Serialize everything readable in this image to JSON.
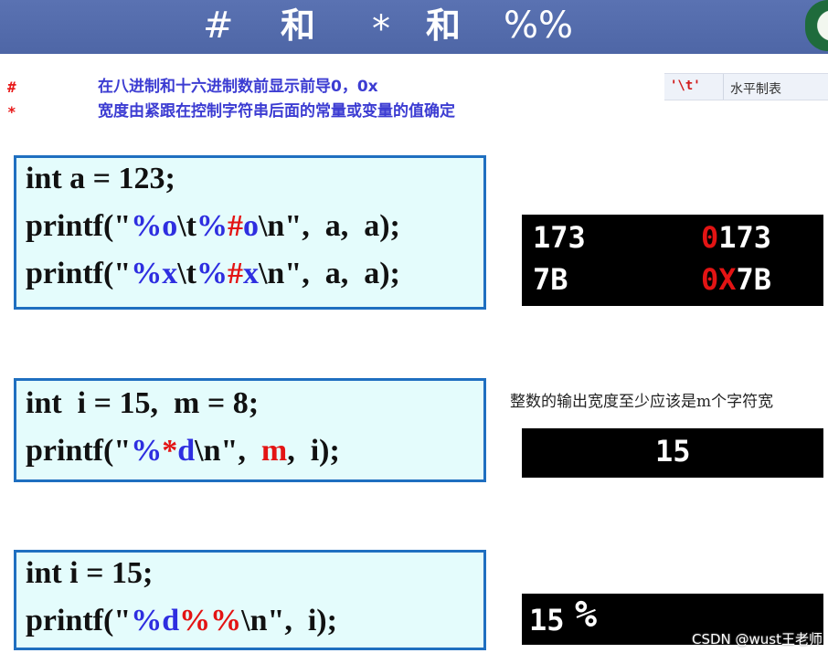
{
  "header": {
    "hash": "#",
    "he1": "和",
    "star": "*",
    "he2": "和",
    "percent": "%%"
  },
  "descriptions": [
    {
      "symbol": "#",
      "text": "在八进制和十六进制数前显示前导0，0x"
    },
    {
      "symbol": "*",
      "text": "宽度由紧跟在控制字符串后面的常量或变量的值确定"
    }
  ],
  "tab_table": {
    "code": "'\\t'",
    "desc": "水平制表"
  },
  "examples": [
    {
      "code": [
        [
          {
            "t": "int a = 123;",
            "c": ""
          }
        ],
        [
          {
            "t": "printf(\"",
            "c": ""
          },
          {
            "t": "%o",
            "c": "b"
          },
          {
            "t": "\\t",
            "c": ""
          },
          {
            "t": "%",
            "c": "b"
          },
          {
            "t": "#",
            "c": "r"
          },
          {
            "t": "o",
            "c": "b"
          },
          {
            "t": "\\n\",  a,  a);",
            "c": ""
          }
        ],
        [
          {
            "t": "printf(\"",
            "c": ""
          },
          {
            "t": "%x",
            "c": "b"
          },
          {
            "t": "\\t",
            "c": ""
          },
          {
            "t": "%",
            "c": "b"
          },
          {
            "t": "#",
            "c": "r"
          },
          {
            "t": "x",
            "c": "b"
          },
          {
            "t": "\\n\",  a,  a);",
            "c": ""
          }
        ]
      ],
      "output": [
        {
          "col1": "173",
          "col2_prefix": "0",
          "col2_rest": "173"
        },
        {
          "col1": "7B",
          "col2_prefix": "0X",
          "col2_rest": "7B"
        }
      ]
    },
    {
      "code": [
        [
          {
            "t": "int  i = 15,  m = 8;",
            "c": ""
          }
        ],
        [
          {
            "t": "printf(\"",
            "c": ""
          },
          {
            "t": "%",
            "c": "b"
          },
          {
            "t": "*",
            "c": "r"
          },
          {
            "t": "d",
            "c": "b"
          },
          {
            "t": "\\n\",  ",
            "c": ""
          },
          {
            "t": "m",
            "c": "r"
          },
          {
            "t": ",  i);",
            "c": ""
          }
        ]
      ],
      "note": "整数的输出宽度至少应该是m个字符宽",
      "output": "15"
    },
    {
      "code": [
        [
          {
            "t": "int i = 15;",
            "c": ""
          }
        ],
        [
          {
            "t": "printf(\"",
            "c": ""
          },
          {
            "t": "%d",
            "c": "b"
          },
          {
            "t": "%%",
            "c": "r"
          },
          {
            "t": "\\n\",  i);",
            "c": ""
          }
        ]
      ],
      "output_num": "15",
      "output_pct": "%"
    }
  ],
  "watermark": "CSDN @wust王老师"
}
